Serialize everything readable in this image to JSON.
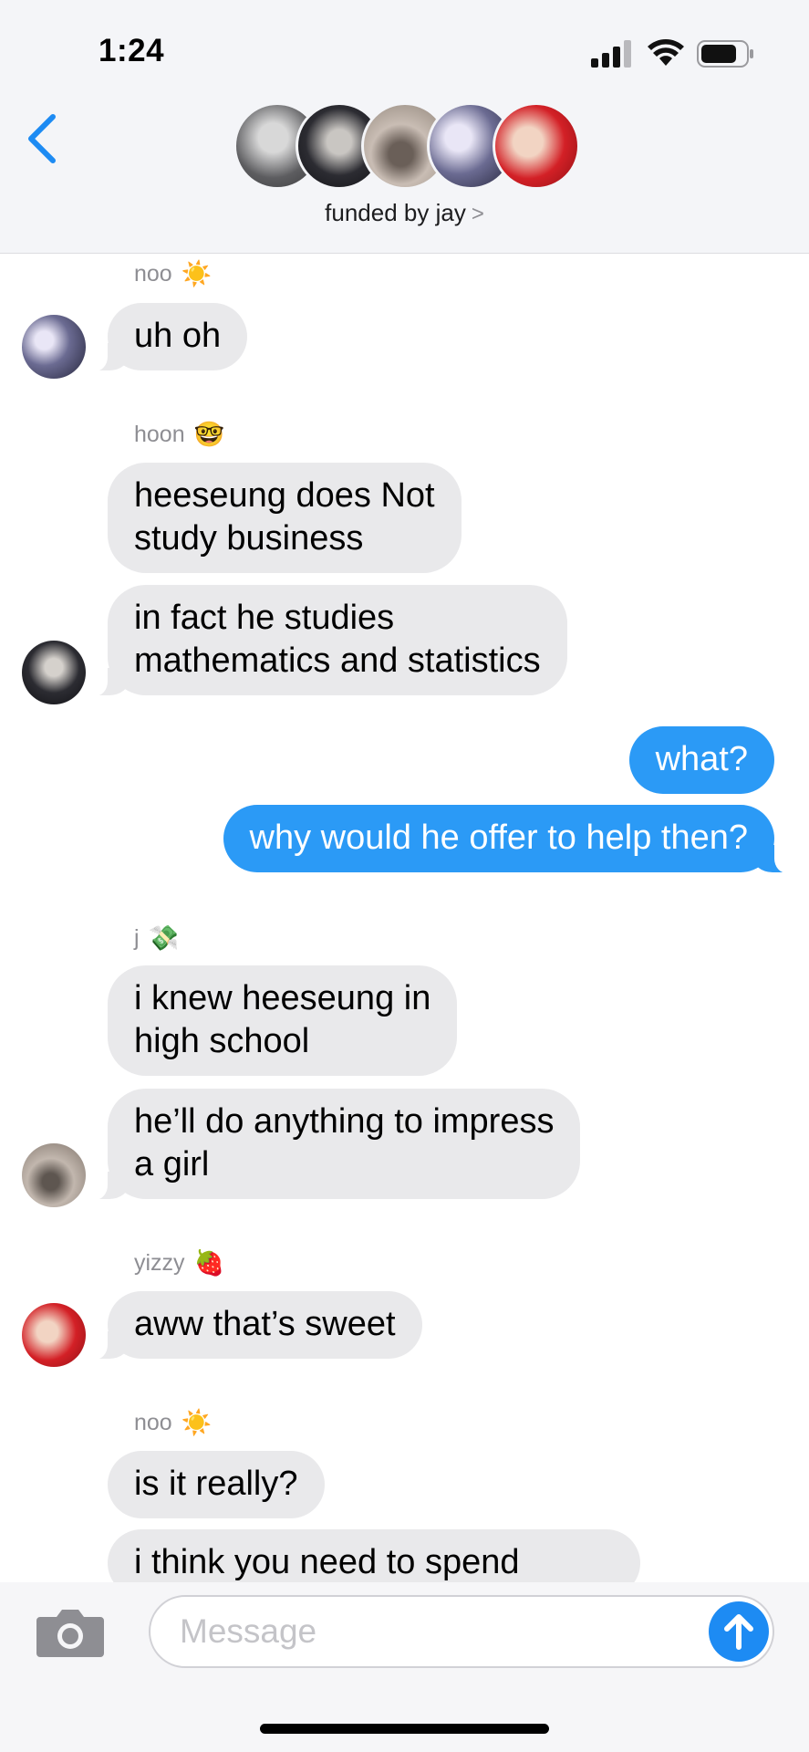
{
  "status_bar": {
    "time": "1:24"
  },
  "header": {
    "group_name": "funded by jay",
    "chevron": ">",
    "avatars": [
      {
        "name": "member-1",
        "color_a": "#6b6b6b",
        "color_b": "#cfcfcf"
      },
      {
        "name": "member-2",
        "color_a": "#2a2a30",
        "color_b": "#9a9aa0"
      },
      {
        "name": "member-3",
        "color_a": "#b8aca4",
        "color_b": "#6a5f58"
      },
      {
        "name": "member-4",
        "color_a": "#3c3c5a",
        "color_b": "#d6d2e6"
      },
      {
        "name": "member-5",
        "color_a": "#d32026",
        "color_b": "#f1c9b8"
      }
    ]
  },
  "messages": {
    "m1": {
      "sender": "noo",
      "emoji": "☀️",
      "text": "uh oh"
    },
    "m2": {
      "sender": "hoon",
      "emoji": "🤓",
      "text1": "heeseung does Not\nstudy business",
      "text2": "in fact he studies\nmathematics and statistics"
    },
    "m3": {
      "text1": "what?",
      "text2": "why would he offer to help then?"
    },
    "m4": {
      "sender": "j",
      "emoji": "💸",
      "text1": "i knew heeseung in\nhigh school",
      "text2": "he’ll do anything to impress\na girl"
    },
    "m5": {
      "sender": "yizzy",
      "emoji": "🍓",
      "text": "aww that’s sweet"
    },
    "m6": {
      "sender": "noo",
      "emoji": "☀️",
      "text1": "is it really?",
      "text2": "i think you need to spend"
    }
  },
  "composer": {
    "placeholder": "Message"
  },
  "colors": {
    "sent_bubble": "#2b9af6",
    "received_bubble": "#e9e9eb",
    "accent": "#1d8bf3"
  }
}
